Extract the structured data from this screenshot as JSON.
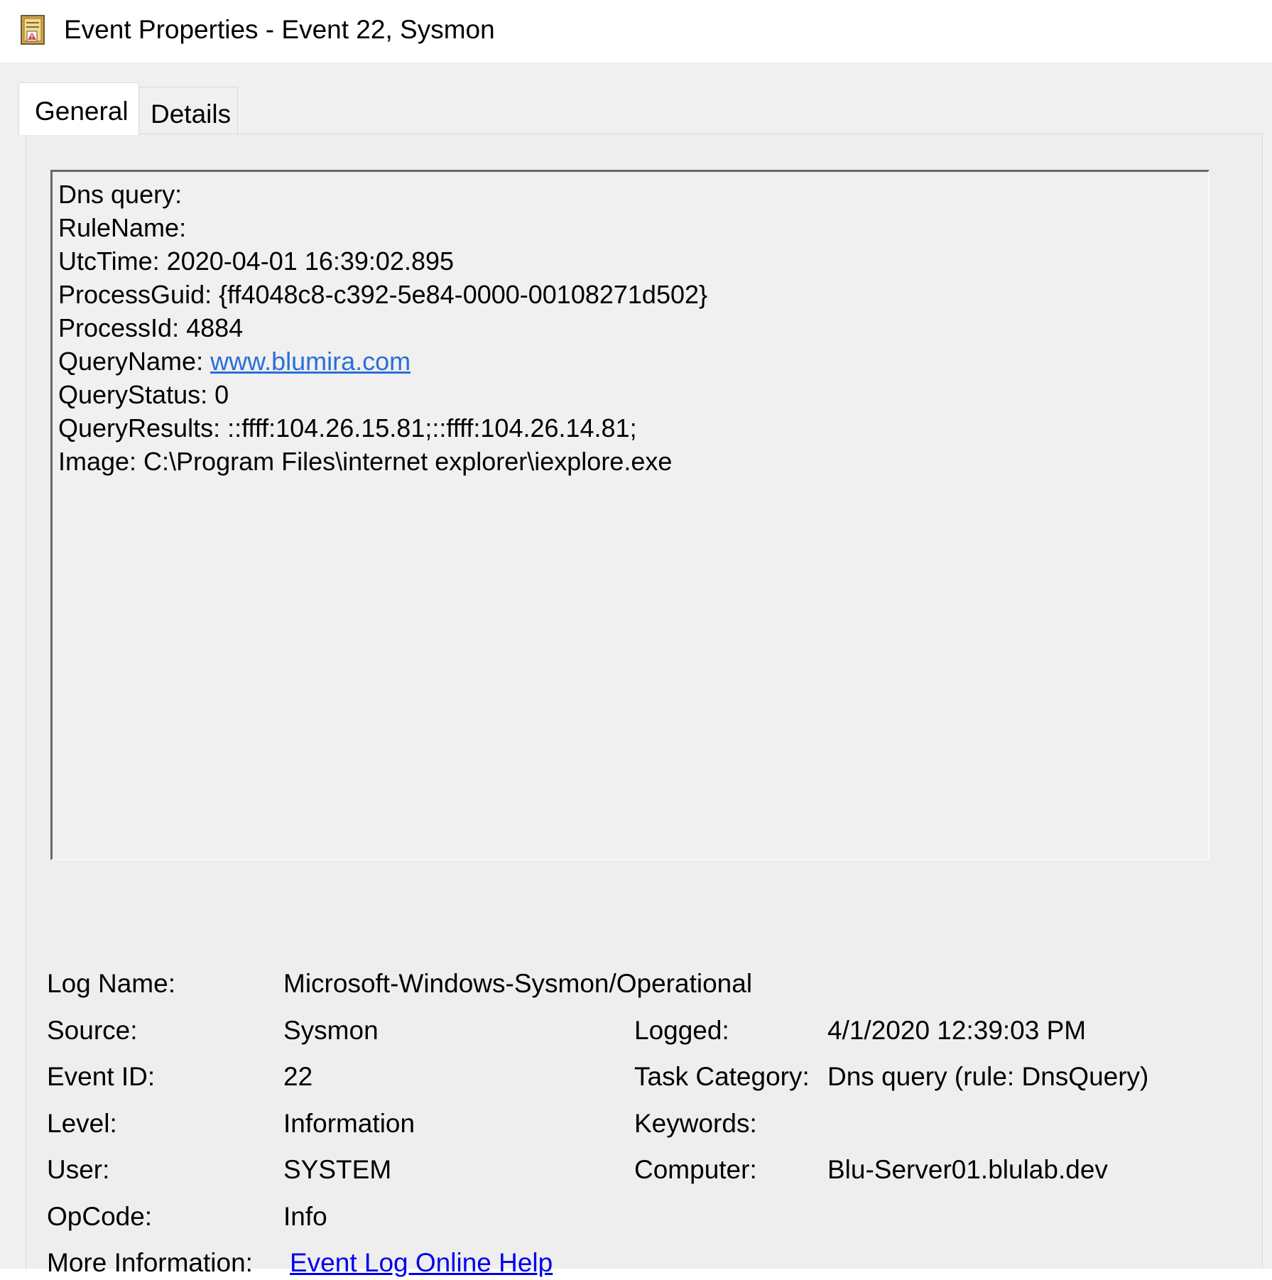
{
  "window": {
    "title": "Event Properties - Event 22, Sysmon",
    "icon": "event-viewer-icon"
  },
  "tabs": [
    {
      "label": "General",
      "selected": true
    },
    {
      "label": "Details",
      "selected": false
    }
  ],
  "description": {
    "line1": "Dns query:",
    "line2": "RuleName:",
    "line3": "UtcTime: 2020-04-01 16:39:02.895",
    "line4": "ProcessGuid: {ff4048c8-c392-5e84-0000-00108271d502}",
    "line5": "ProcessId: 4884",
    "query_name_label": "QueryName: ",
    "query_name_link": "www.blumira.com",
    "line7": "QueryStatus: 0",
    "line8": "QueryResults: ::ffff:104.26.15.81;::ffff:104.26.14.81;",
    "line9": "Image: C:\\Program Files\\internet explorer\\iexplore.exe"
  },
  "properties": {
    "log_name": {
      "label": "Log Name:",
      "value": "Microsoft-Windows-Sysmon/Operational"
    },
    "source": {
      "label": "Source:",
      "value": "Sysmon"
    },
    "logged": {
      "label": "Logged:",
      "value": "4/1/2020 12:39:03 PM"
    },
    "event_id": {
      "label": "Event ID:",
      "value": "22"
    },
    "task_category": {
      "label": "Task Category:",
      "value": "Dns query (rule: DnsQuery)"
    },
    "level": {
      "label": "Level:",
      "value": "Information"
    },
    "keywords": {
      "label": "Keywords:",
      "value": ""
    },
    "user": {
      "label": "User:",
      "value": "SYSTEM"
    },
    "computer": {
      "label": "Computer:",
      "value": "Blu-Server01.blulab.dev"
    },
    "opcode": {
      "label": "OpCode:",
      "value": "Info"
    },
    "more_info": {
      "label": "More Information:",
      "link": "Event Log Online Help"
    }
  },
  "colors": {
    "window_bg": "#f0f0f0",
    "link": "#0000ee",
    "url_link": "#2a6fd6"
  },
  "cursor": "mouse-pointer-icon"
}
